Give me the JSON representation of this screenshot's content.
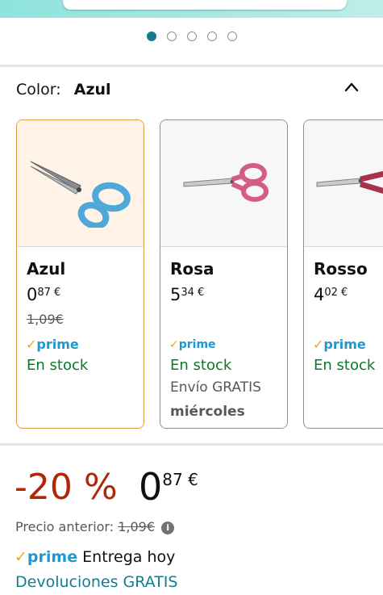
{
  "carousel": {
    "dot_count": 5,
    "active_index": 0
  },
  "color_selector": {
    "label": "Color:",
    "selected": "Azul"
  },
  "swatches": [
    {
      "name": "Azul",
      "price_whole": "0",
      "price_cents": "87 €",
      "old_price": "1,09€",
      "prime": "prime",
      "stock": "En stock",
      "selected": true,
      "handle_color": "#4ea8d8"
    },
    {
      "name": "Rosa",
      "price_whole": "5",
      "price_cents": "34 €",
      "prime": "prime",
      "stock": "En stock",
      "shipping": "Envío GRATIS",
      "delivery_day": "miércoles",
      "selected": false,
      "handle_color": "#d45c86"
    },
    {
      "name": "Rosso",
      "price_whole": "4",
      "price_cents": "02 €",
      "prime": "prime",
      "stock": "En stock",
      "selected": false,
      "handle_color": "#a8324a"
    }
  ],
  "price_block": {
    "discount": "-20 %",
    "price_whole": "0",
    "price_cents": "87 €",
    "previous_label": "Precio anterior:",
    "previous_price": "1,09€"
  },
  "delivery": {
    "prime": "prime",
    "text": "Entrega hoy"
  },
  "returns": "Devoluciones GRATIS",
  "colors": {
    "accent": "#147c8f",
    "discount": "#b12704",
    "stock": "#067d25",
    "prime_blue": "#1f98d2",
    "prime_check": "#f1a51a",
    "selected_border": "#e0a041"
  }
}
